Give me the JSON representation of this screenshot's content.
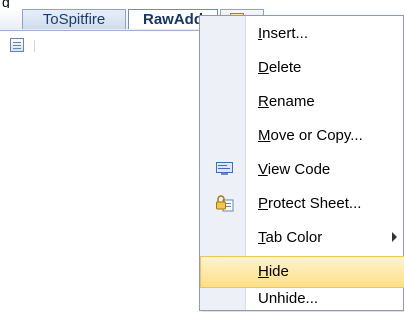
{
  "top_fragment": "g",
  "sheet_tabs": {
    "tospitfire": "ToSpitfire",
    "rawadd": "RawAdd"
  },
  "context_menu": {
    "items": [
      {
        "prefix": "",
        "mnemonic": "I",
        "rest": "nsert..."
      },
      {
        "prefix": "",
        "mnemonic": "D",
        "rest": "elete"
      },
      {
        "prefix": "",
        "mnemonic": "R",
        "rest": "ename"
      },
      {
        "prefix": "",
        "mnemonic": "M",
        "rest": "ove or Copy..."
      },
      {
        "prefix": "",
        "mnemonic": "V",
        "rest": "iew Code",
        "icon": "view-code-icon"
      },
      {
        "prefix": "",
        "mnemonic": "P",
        "rest": "rotect Sheet...",
        "icon": "protect-sheet-icon"
      },
      {
        "prefix": "",
        "mnemonic": "T",
        "rest": "ab Color",
        "submenu": true
      },
      {
        "prefix": "",
        "mnemonic": "H",
        "rest": "ide",
        "highlighted": true
      },
      {
        "prefix": "",
        "mnemonic": "",
        "rest": "Unhide..."
      }
    ]
  },
  "colors": {
    "menu_highlight": "#ffdf86",
    "tab_text": "#1c3d6b",
    "menu_border": "#8f9bb4"
  }
}
